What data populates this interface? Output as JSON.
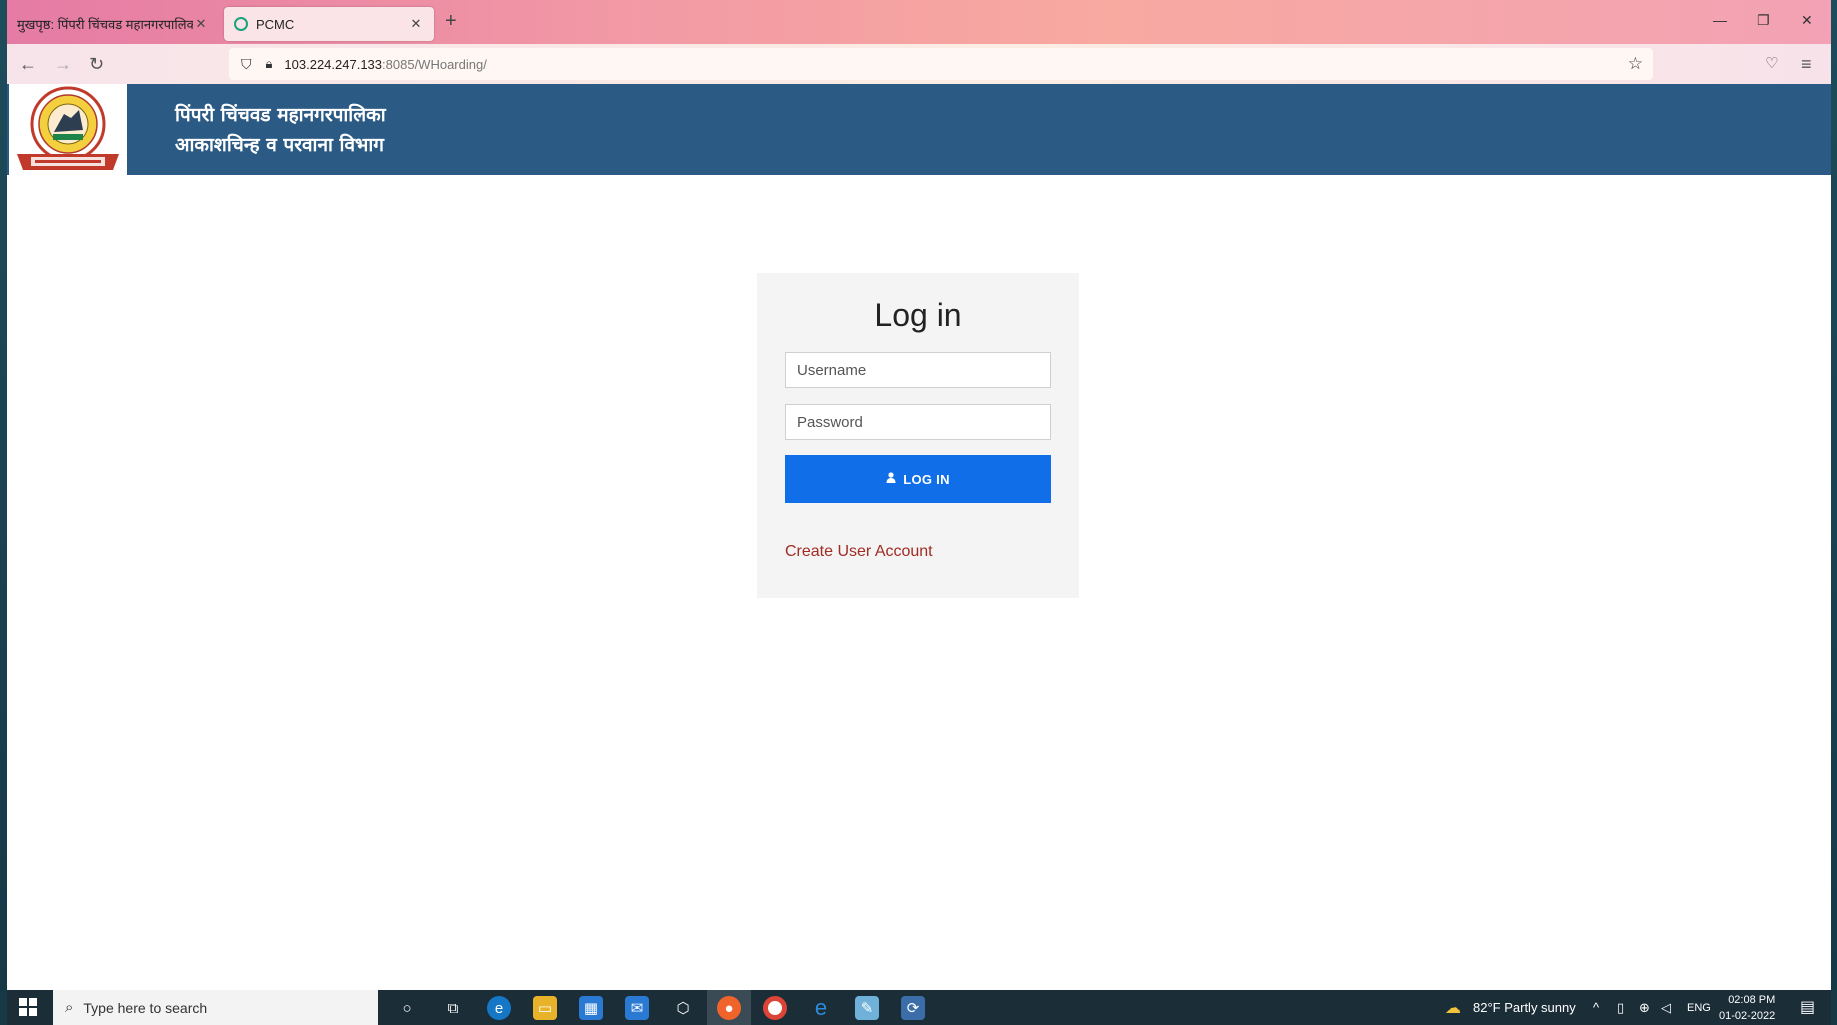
{
  "browser": {
    "tabs": [
      {
        "title": "मुखपृष्ठ: पिंपरी चिंचवड महानगरपालिका",
        "active": false
      },
      {
        "title": "PCMC",
        "active": true
      }
    ],
    "url_host": "103.224.247.133",
    "url_path": ":8085/WHoarding/"
  },
  "header": {
    "org_line1": "पिंपरी चिंचवड महानगरपालिका",
    "org_line2": "आकाशचिन्ह व परवाना विभाग"
  },
  "login": {
    "title": "Log in",
    "username_placeholder": "Username",
    "password_placeholder": "Password",
    "button_label": "LOG IN",
    "create_account_label": "Create User Account"
  },
  "taskbar": {
    "search_placeholder": "Type here to search",
    "weather": "82°F  Partly sunny",
    "language": "ENG",
    "time": "02:08 PM",
    "date": "01-02-2022"
  },
  "colors": {
    "header_bg": "#2b5a84",
    "login_button": "#0f6ee8",
    "link": "#a02c24"
  }
}
